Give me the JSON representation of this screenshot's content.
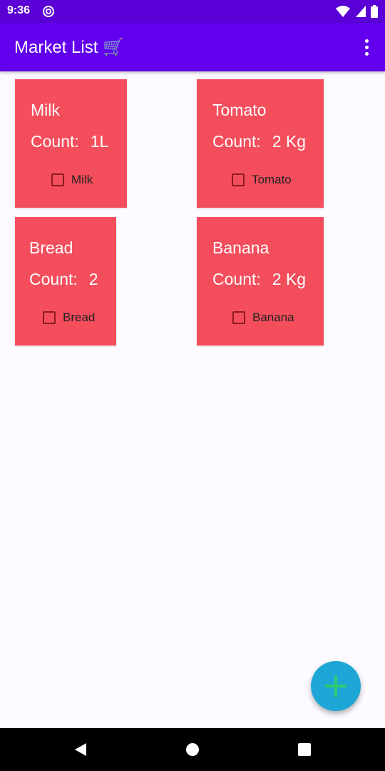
{
  "status": {
    "time": "9:36"
  },
  "app": {
    "title": "Market List 🛒"
  },
  "items": [
    {
      "name": "Milk",
      "count_label": "Count:",
      "count": "1L",
      "check_label": "Milk"
    },
    {
      "name": "Tomato",
      "count_label": "Count:",
      "count": "2 Kg",
      "check_label": "Tomato"
    },
    {
      "name": "Bread",
      "count_label": "Count:",
      "count": "2",
      "check_label": "Bread"
    },
    {
      "name": "Banana",
      "count_label": "Count:",
      "count": "2 Kg",
      "check_label": "Banana"
    }
  ],
  "colors": {
    "status_bar": "#5a00d6",
    "app_bar": "#6200ee",
    "card": "#f44d5c",
    "fab": "#1ea7d6",
    "fab_icon": "#2ecc71"
  },
  "icons": {
    "status_left": "at-sign-icon",
    "wifi": "wifi-icon",
    "signal": "signal-icon",
    "battery": "battery-icon",
    "menu": "more-vert-icon",
    "fab": "plus-icon",
    "back": "back-triangle-icon",
    "home": "home-circle-icon",
    "recents": "recents-square-icon"
  }
}
